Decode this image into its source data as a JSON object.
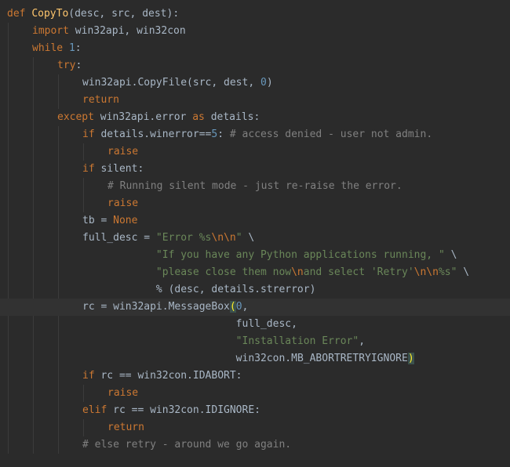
{
  "editor": {
    "language": "python",
    "current_line": 18,
    "lines": [
      {
        "indent": 0,
        "tokens": [
          {
            "t": "def ",
            "c": "kw"
          },
          {
            "t": "CopyTo",
            "c": "fn"
          },
          {
            "t": "(desc, src, dest):",
            "c": "plain"
          }
        ]
      },
      {
        "indent": 1,
        "tokens": [
          {
            "t": "import ",
            "c": "kw"
          },
          {
            "t": "win32api, win32con",
            "c": "plain"
          }
        ]
      },
      {
        "indent": 1,
        "tokens": [
          {
            "t": "while ",
            "c": "kw"
          },
          {
            "t": "1",
            "c": "num"
          },
          {
            "t": ":",
            "c": "plain"
          }
        ]
      },
      {
        "indent": 2,
        "tokens": [
          {
            "t": "try",
            "c": "kw"
          },
          {
            "t": ":",
            "c": "plain"
          }
        ]
      },
      {
        "indent": 3,
        "tokens": [
          {
            "t": "win32api.CopyFile(src, dest, ",
            "c": "plain"
          },
          {
            "t": "0",
            "c": "num"
          },
          {
            "t": ")",
            "c": "plain"
          }
        ]
      },
      {
        "indent": 3,
        "tokens": [
          {
            "t": "return",
            "c": "kw"
          }
        ]
      },
      {
        "indent": 2,
        "tokens": [
          {
            "t": "except ",
            "c": "kw"
          },
          {
            "t": "win32api.error ",
            "c": "plain"
          },
          {
            "t": "as ",
            "c": "kw"
          },
          {
            "t": "details:",
            "c": "plain"
          }
        ]
      },
      {
        "indent": 3,
        "tokens": [
          {
            "t": "if ",
            "c": "kw"
          },
          {
            "t": "details.winerror==",
            "c": "plain"
          },
          {
            "t": "5",
            "c": "num"
          },
          {
            "t": ": ",
            "c": "plain"
          },
          {
            "t": "# access denied - user not admin.",
            "c": "cm"
          }
        ]
      },
      {
        "indent": 4,
        "tokens": [
          {
            "t": "raise",
            "c": "kw"
          }
        ]
      },
      {
        "indent": 3,
        "tokens": [
          {
            "t": "if ",
            "c": "kw"
          },
          {
            "t": "silent:",
            "c": "plain"
          }
        ]
      },
      {
        "indent": 4,
        "tokens": [
          {
            "t": "# Running silent mode - just re-raise the error.",
            "c": "cm"
          }
        ]
      },
      {
        "indent": 4,
        "tokens": [
          {
            "t": "raise",
            "c": "kw"
          }
        ]
      },
      {
        "indent": 3,
        "tokens": [
          {
            "t": "tb = ",
            "c": "plain"
          },
          {
            "t": "None",
            "c": "kw"
          }
        ]
      },
      {
        "indent": 3,
        "tokens": [
          {
            "t": "full_desc = ",
            "c": "plain"
          },
          {
            "t": "\"Error %s",
            "c": "str"
          },
          {
            "t": "\\n\\n",
            "c": "esc"
          },
          {
            "t": "\" ",
            "c": "str"
          },
          {
            "t": "\\",
            "c": "plain"
          }
        ]
      },
      {
        "indent": 3,
        "pad": "            ",
        "tokens": [
          {
            "t": "\"If you have any Python applications running, \" ",
            "c": "str"
          },
          {
            "t": "\\",
            "c": "plain"
          }
        ]
      },
      {
        "indent": 3,
        "pad": "            ",
        "tokens": [
          {
            "t": "\"please close them now",
            "c": "str"
          },
          {
            "t": "\\n",
            "c": "esc"
          },
          {
            "t": "and select 'Retry'",
            "c": "str"
          },
          {
            "t": "\\n\\n",
            "c": "esc"
          },
          {
            "t": "%s\" ",
            "c": "str"
          },
          {
            "t": "\\",
            "c": "plain"
          }
        ]
      },
      {
        "indent": 3,
        "pad": "            ",
        "tokens": [
          {
            "t": "% (desc, details.strerror)",
            "c": "plain"
          }
        ]
      },
      {
        "indent": 3,
        "tokens": [
          {
            "t": "rc = win32api.",
            "c": "plain"
          },
          {
            "t": "MessageBox",
            "c": "plain"
          },
          {
            "t": "(",
            "c": "bracket"
          },
          {
            "t": "0",
            "c": "num"
          },
          {
            "t": ",",
            "c": "plain"
          }
        ]
      },
      {
        "indent": 3,
        "pad": "                         ",
        "tokens": [
          {
            "t": "full_desc,",
            "c": "plain"
          }
        ]
      },
      {
        "indent": 3,
        "pad": "                         ",
        "tokens": [
          {
            "t": "\"Installation Error\"",
            "c": "str"
          },
          {
            "t": ",",
            "c": "plain"
          }
        ]
      },
      {
        "indent": 3,
        "pad": "                         ",
        "tokens": [
          {
            "t": "win32con.MB_ABORTRETRYIGNORE",
            "c": "plain"
          },
          {
            "t": ")",
            "c": "bracket"
          }
        ]
      },
      {
        "indent": 3,
        "tokens": [
          {
            "t": "if ",
            "c": "kw"
          },
          {
            "t": "rc == win32con.IDABORT:",
            "c": "plain"
          }
        ]
      },
      {
        "indent": 4,
        "tokens": [
          {
            "t": "raise",
            "c": "kw"
          }
        ]
      },
      {
        "indent": 3,
        "tokens": [
          {
            "t": "elif ",
            "c": "kw"
          },
          {
            "t": "rc == win32con.IDIGNORE:",
            "c": "plain"
          }
        ]
      },
      {
        "indent": 4,
        "tokens": [
          {
            "t": "return",
            "c": "kw"
          }
        ]
      },
      {
        "indent": 3,
        "tokens": [
          {
            "t": "# else retry - around we go again.",
            "c": "cm"
          }
        ]
      }
    ]
  }
}
